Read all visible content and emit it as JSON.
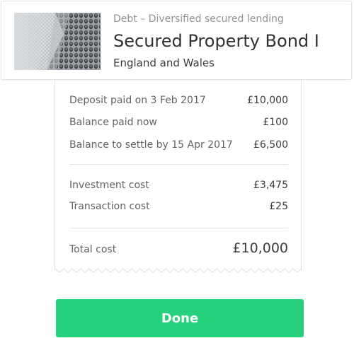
{
  "header": {
    "category": "Debt – Diversified secured lending",
    "title": "Secured Property Bond I",
    "location": "England and Wales",
    "thumbnail_icon": "building-facade-image"
  },
  "receipt": {
    "payments": [
      {
        "label": "Deposit paid on 3 Feb 2017",
        "value": "£10,000"
      },
      {
        "label": "Balance paid now",
        "value": "£100"
      },
      {
        "label": "Balance to settle by 15 Apr 2017",
        "value": "£6,500"
      }
    ],
    "costs": [
      {
        "label": "Investment cost",
        "value": "£3,475"
      },
      {
        "label": "Transaction cost",
        "value": "£25"
      }
    ],
    "total": {
      "label": "Total cost",
      "value": "£10,000"
    }
  },
  "actions": {
    "done_label": "Done"
  },
  "colors": {
    "accent": "#27d07a",
    "total_value": "#2ecc71"
  }
}
